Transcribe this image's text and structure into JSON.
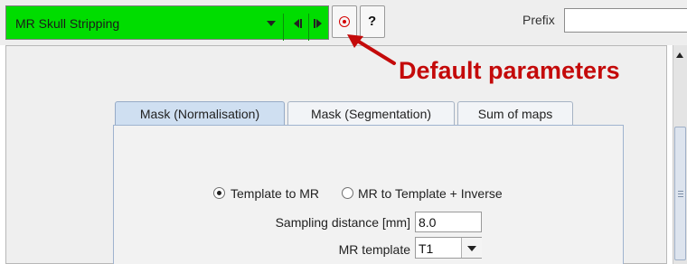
{
  "toolbar": {
    "module_combo": {
      "selected": "MR Skull Stripping",
      "icon": "chevron-down-icon"
    },
    "nav_icons": {
      "prev": "previous-icon",
      "next": "next-icon"
    },
    "default_button": {
      "icon": "target-icon"
    },
    "help_button": {
      "label": "?"
    },
    "prefix": {
      "label": "Prefix",
      "value": ""
    }
  },
  "annotation": {
    "text": "Default parameters",
    "color": "#c40a0a"
  },
  "tabs": [
    {
      "label": "Mask (Normalisation)",
      "active": true
    },
    {
      "label": "Mask (Segmentation)",
      "active": false
    },
    {
      "label": "Sum of maps",
      "active": false
    }
  ],
  "form": {
    "radio_options": [
      {
        "label": "Template to MR",
        "selected": true
      },
      {
        "label": "MR to Template + Inverse",
        "selected": false
      }
    ],
    "sampling_distance": {
      "label": "Sampling distance [mm]",
      "value": "8.0"
    },
    "mr_template": {
      "label": "MR template",
      "value": "T1"
    }
  },
  "colors": {
    "accent_green": "#00dd00",
    "tab_active": "#cfdff1"
  }
}
